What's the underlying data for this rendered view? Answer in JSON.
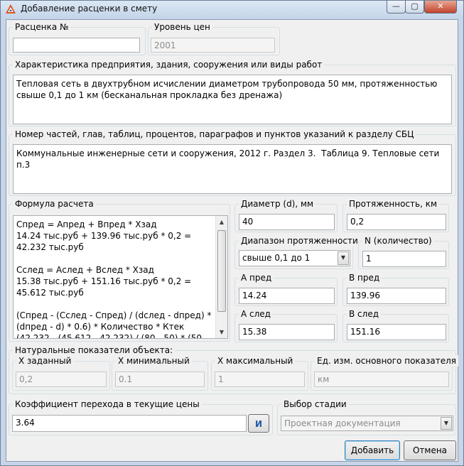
{
  "window": {
    "title": "Добавление расценки в смету",
    "minimize_glyph": "—",
    "maximize_glyph": "▢",
    "close_glyph": "✕"
  },
  "rate_number": {
    "label": "Расценка №",
    "value": ""
  },
  "price_level": {
    "label": "Уровень цен",
    "value": "2001"
  },
  "characteristics": {
    "label": "Характеристика предприятия, здания, сооружения или виды работ",
    "value": "Тепловая сеть в двухтрубном исчислении диаметром трубопровода 50 мм, протяженностью свыше 0,1 до 1 км (бесканальная прокладка без дренажа)"
  },
  "sbc_reference": {
    "label": "Номер частей, глав, таблиц, процентов, параграфов и пунктов указаний к разделу СБЦ",
    "value": "Коммунальные инженерные сети и сооружения, 2012 г. Раздел 3.  Таблица 9. Тепловые сети п.3"
  },
  "formula": {
    "label": "Формула расчета",
    "text": "Спред = Апред + Впред * Хзад\n14.24 тыс.руб + 139.96 тыс.руб * 0,2 = 42.232 тыс.руб\n\nСслед = Аслед + Вслед * Хзад\n15.38 тыс.руб + 151.16 тыс.руб * 0,2 = 45.612 тыс.руб\n\n(Спред - (Сслед - Спред) / (dслед - dпред) * (dпред - d) * 0.6) * Количество * Ктек\n(42.232 - (45.612 - 42.232) / (80 - 50) * (50",
    "scroll_up_glyph": "▲",
    "scroll_down_glyph": "▼"
  },
  "diameter": {
    "label": "Диаметр (d), мм",
    "value": "40"
  },
  "length": {
    "label": "Протяженность, км",
    "value": "0,2"
  },
  "length_range": {
    "label": "Диапазон протяженности",
    "value": "свыше 0,1 до 1",
    "arrow_glyph": "▼"
  },
  "quantity": {
    "label": "N (количество)",
    "value": "1"
  },
  "a_prev": {
    "label": "А пред",
    "value": "14.24"
  },
  "b_prev": {
    "label": "В пред",
    "value": "139.96"
  },
  "a_next": {
    "label": "А след",
    "value": "15.38"
  },
  "b_next": {
    "label": "В след",
    "value": "151.16"
  },
  "natural": {
    "label": "Натуральные показатели объекта:",
    "x_given": {
      "label": "Х заданный",
      "value": "0,2"
    },
    "x_min": {
      "label": "Х минимальный",
      "value": "0.1"
    },
    "x_max": {
      "label": "Х максимальный",
      "value": "1"
    },
    "unit": {
      "label": "Ед. изм. основного показателя",
      "value": "км"
    }
  },
  "coefficient": {
    "label": "Коэффициент перехода в текущие цены",
    "value": "3.64",
    "button_label": "И"
  },
  "stage": {
    "label": "Выбор стадии",
    "value": "Проектная документация",
    "arrow_glyph": "▼"
  },
  "buttons": {
    "add": "Добавить",
    "cancel": "Отмена"
  },
  "colors": {
    "title_gradient_top": "#dbe7f4",
    "close_red": "#c2432a",
    "form_bg": "#f0f0f0",
    "accent_blue": "#1e5aa8"
  }
}
